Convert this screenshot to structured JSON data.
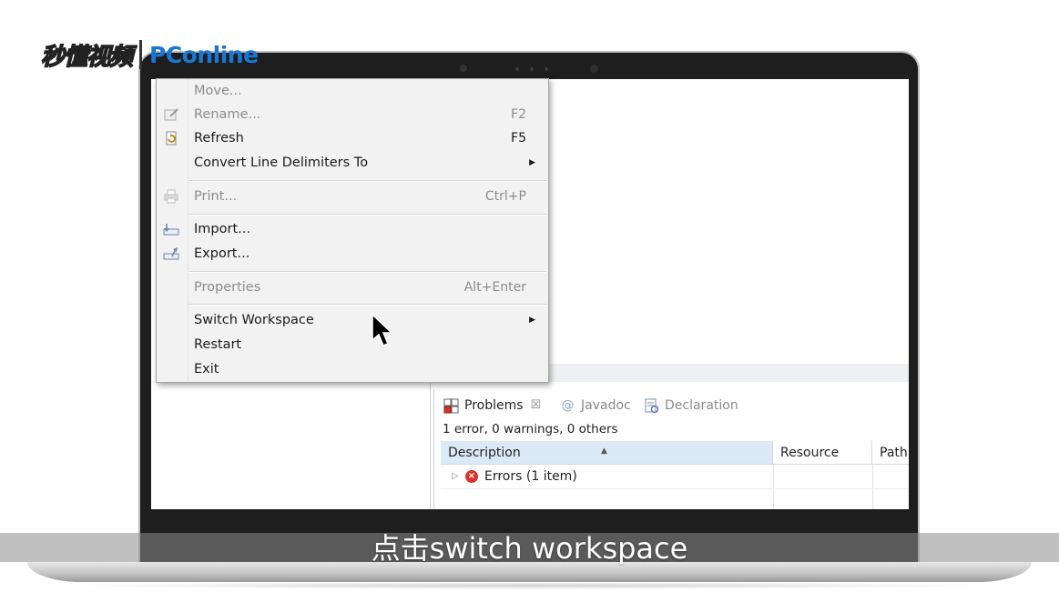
{
  "watermark": {
    "brand_cn": "秒懂视频",
    "brand_en": "PConline"
  },
  "file_menu": {
    "items": [
      {
        "label": "Move...",
        "shortcut": "",
        "disabled": true,
        "submenu": false,
        "icon": ""
      },
      {
        "label": "Rename...",
        "shortcut": "F2",
        "disabled": true,
        "submenu": false,
        "icon": "rename-icon"
      },
      {
        "label": "Refresh",
        "shortcut": "F5",
        "disabled": false,
        "submenu": false,
        "icon": "refresh-icon"
      },
      {
        "label": "Convert Line Delimiters To",
        "shortcut": "",
        "disabled": false,
        "submenu": true,
        "icon": ""
      },
      {
        "label": "Print...",
        "shortcut": "Ctrl+P",
        "disabled": true,
        "submenu": false,
        "icon": "print-icon"
      },
      {
        "label": "Import...",
        "shortcut": "",
        "disabled": false,
        "submenu": false,
        "icon": "import-icon"
      },
      {
        "label": "Export...",
        "shortcut": "",
        "disabled": false,
        "submenu": false,
        "icon": "export-icon"
      },
      {
        "label": "Properties",
        "shortcut": "Alt+Enter",
        "disabled": true,
        "submenu": false,
        "icon": ""
      },
      {
        "label": "Switch Workspace",
        "shortcut": "",
        "disabled": false,
        "submenu": true,
        "icon": ""
      },
      {
        "label": "Restart",
        "shortcut": "",
        "disabled": false,
        "submenu": false,
        "icon": ""
      },
      {
        "label": "Exit",
        "shortcut": "",
        "disabled": false,
        "submenu": false,
        "icon": ""
      }
    ]
  },
  "problems_view": {
    "tabs": [
      {
        "label": "Problems",
        "active": true,
        "icon": "problems-icon"
      },
      {
        "label": "Javadoc",
        "active": false,
        "icon": "javadoc-icon"
      },
      {
        "label": "Declaration",
        "active": false,
        "icon": "declaration-icon"
      }
    ],
    "close_glyph": "☒",
    "summary": "1 error, 0 warnings, 0 others",
    "columns": [
      "Description",
      "Resource",
      "Path"
    ],
    "rows": [
      {
        "description": "Errors (1 item)"
      }
    ]
  },
  "subtitle": "点击switch workspace",
  "colors": {
    "menu_bg": "#f2f2f2",
    "header_selected": "#dceaf8",
    "error_red": "#d6342c",
    "brand_blue": "#1a78d4"
  }
}
